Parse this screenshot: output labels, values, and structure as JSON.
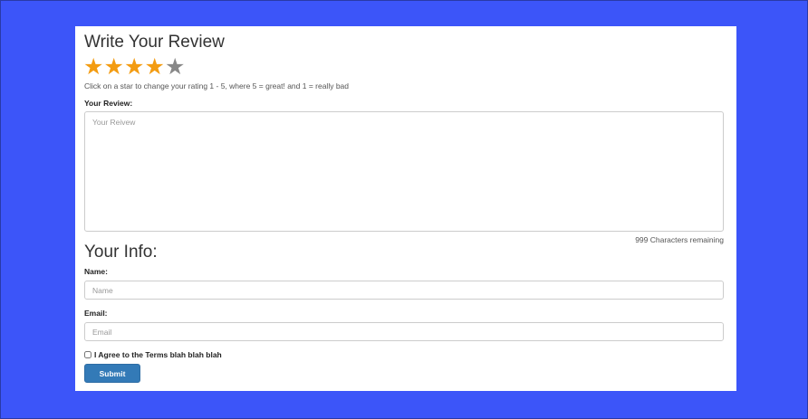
{
  "review": {
    "title": "Write Your Review",
    "rating": 4,
    "max_rating": 5,
    "star_glyph": "★",
    "star_active_color": "#f39c12",
    "star_inactive_color": "#888888",
    "hint": "Click on a star to change your rating 1 - 5, where 5 = great! and 1 = really bad",
    "review_label": "Your Review:",
    "review_placeholder": "Your Reivew",
    "chars_remaining": "999 Characters remaining"
  },
  "info": {
    "title": "Your Info:",
    "name_label": "Name:",
    "name_placeholder": "Name",
    "email_label": "Email:",
    "email_placeholder": "Email",
    "agree_label": "I Agree to the Terms blah blah blah",
    "agree_checked": false,
    "submit_label": "Submit"
  },
  "colors": {
    "background": "#3c55f9",
    "primary_button": "#337ab7"
  }
}
